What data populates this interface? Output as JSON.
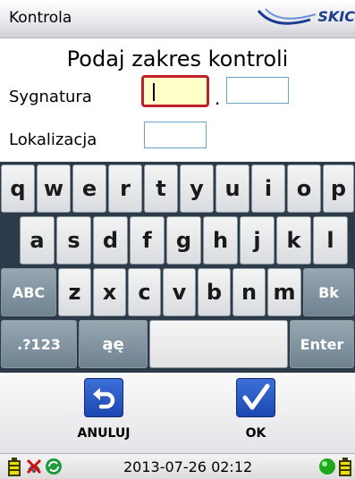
{
  "titlebar": {
    "title": "Kontrola",
    "logo_text": "SKIC"
  },
  "form": {
    "heading": "Podaj zakres kontroli",
    "sygnatura_label": "Sygnatura",
    "separator": ".",
    "lokalizacja_label": "Lokalizacja",
    "sygnatura_value": "",
    "sygnatura_suffix_value": "",
    "lokalizacja_value": ""
  },
  "keyboard": {
    "row1": [
      "q",
      "w",
      "e",
      "r",
      "t",
      "y",
      "u",
      "i",
      "o",
      "p"
    ],
    "row2": [
      "a",
      "s",
      "d",
      "f",
      "g",
      "h",
      "j",
      "k",
      "l"
    ],
    "row3": [
      "ABC",
      "z",
      "x",
      "c",
      "v",
      "b",
      "n",
      "m",
      "Bk"
    ],
    "row4": [
      ".?123",
      "ąę",
      "",
      "Enter"
    ]
  },
  "buttons": {
    "cancel_label": "ANULUJ",
    "ok_label": "OK"
  },
  "statusbar": {
    "datetime": "2013-07-26 02:12"
  },
  "colors": {
    "focus_border": "#c0202a",
    "focus_fill": "#ffffc8",
    "button_blue": "#1b48b0",
    "keyboard_bg": "#2b3b4a",
    "func_key": "#7d8f9c"
  }
}
